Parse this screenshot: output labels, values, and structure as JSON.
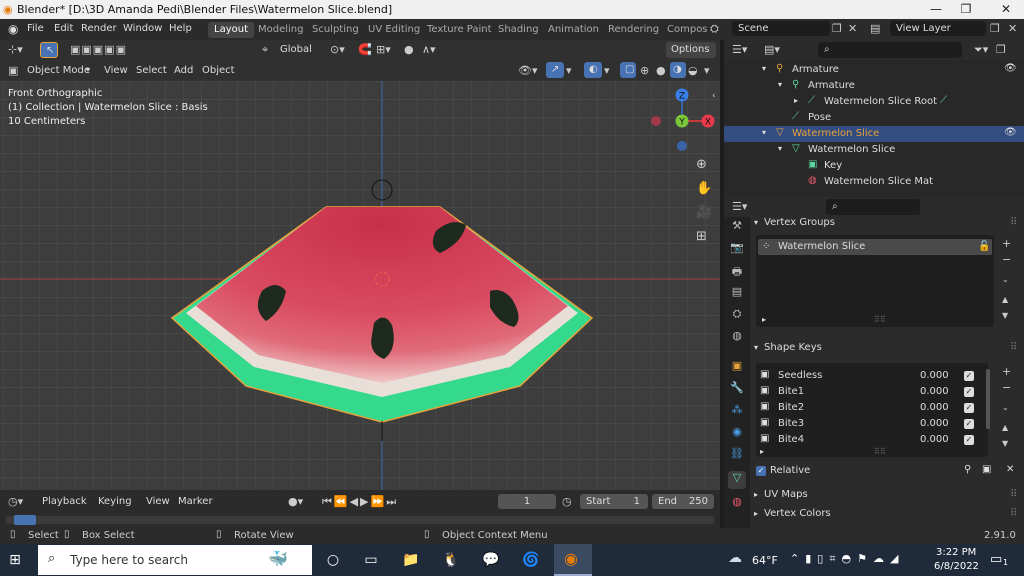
{
  "titlebar": {
    "title": "Blender* [D:\\3D Amanda Pedi\\Blender Files\\Watermelon Slice.blend]"
  },
  "menus": [
    "File",
    "Edit",
    "Render",
    "Window",
    "Help"
  ],
  "workspaces": [
    "Layout",
    "Modeling",
    "Sculpting",
    "UV Editing",
    "Texture Paint",
    "Shading",
    "Animation",
    "Rendering",
    "Compos"
  ],
  "scene": "Scene",
  "view_layer": "View Layer",
  "toolbar": {
    "orientation": "Global",
    "options": "Options"
  },
  "viewport_header": {
    "mode": "Object Mode",
    "view": "View",
    "select": "Select",
    "add": "Add",
    "object": "Object"
  },
  "viewport": {
    "view_name": "Front Orthographic",
    "collection_info": "(1) Collection | Watermelon Slice : Basis",
    "scale": "10 Centimeters",
    "gizmo": {
      "z": "Z",
      "y": "Y",
      "x": "X"
    }
  },
  "outliner": {
    "rows": [
      "Armature",
      "Armature",
      "Watermelon Slice Root",
      "Pose",
      "Watermelon Slice",
      "Watermelon Slice",
      "Key",
      "Watermelon Slice Mat"
    ]
  },
  "properties": {
    "vertex_groups_title": "Vertex Groups",
    "vertex_group_item": "Watermelon Slice",
    "shape_keys_title": "Shape Keys",
    "shape_keys": [
      {
        "name": "Seedless",
        "value": "0.000"
      },
      {
        "name": "Bite1",
        "value": "0.000"
      },
      {
        "name": "Bite2",
        "value": "0.000"
      },
      {
        "name": "Bite3",
        "value": "0.000"
      },
      {
        "name": "Bite4",
        "value": "0.000"
      }
    ],
    "relative_label": "Relative",
    "uv_maps_title": "UV Maps",
    "vertex_colors_title": "Vertex Colors"
  },
  "timeline": {
    "playback": "Playback",
    "keying": "Keying",
    "view": "View",
    "marker": "Marker",
    "current_frame": "1",
    "start_label": "Start",
    "start": "1",
    "end_label": "End",
    "end": "250"
  },
  "statusbar": {
    "select": "Select",
    "box_select": "Box Select",
    "rotate_view": "Rotate View",
    "context_menu": "Object Context Menu",
    "version": "2.91.0"
  },
  "taskbar": {
    "search_placeholder": "Type here to search",
    "weather": "64°F",
    "time": "3:22 PM",
    "date": "6/8/2022",
    "notifications": "1"
  },
  "colors": {
    "accent": "#4772b3",
    "selection": "#334d80",
    "watermelon_flesh": "#d9485e",
    "rind": "#2dd98a",
    "seed": "#1e2a1e"
  }
}
